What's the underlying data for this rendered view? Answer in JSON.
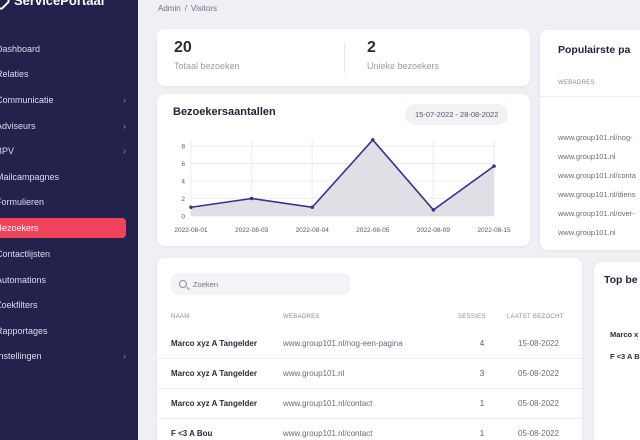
{
  "brand": {
    "name": "ServicePortaal"
  },
  "sidebar": {
    "items": [
      {
        "label": "Dashboard",
        "chevron": false
      },
      {
        "label": "Relaties",
        "chevron": false
      },
      {
        "label": "Communicatie",
        "chevron": true
      },
      {
        "label": "Adviseurs",
        "chevron": true
      },
      {
        "label": "BPV",
        "chevron": true
      },
      {
        "label": "Mailcampagnes",
        "chevron": false
      },
      {
        "label": "Formulieren",
        "chevron": false
      },
      {
        "label": "Bezoekers",
        "chevron": false,
        "active": true
      },
      {
        "label": "Contactlijsten",
        "chevron": false
      },
      {
        "label": "Automations",
        "chevron": false
      },
      {
        "label": "Zoekfilters",
        "chevron": false
      },
      {
        "label": "Rapportages",
        "chevron": false
      },
      {
        "label": "Instellingen",
        "chevron": true
      }
    ],
    "chevron_glyph": "›"
  },
  "breadcrumb": {
    "root": "Admin",
    "separator": "/",
    "current": "Visitors"
  },
  "stats": {
    "total": {
      "value": "20",
      "label": "Totaal bezoeken"
    },
    "unique": {
      "value": "2",
      "label": "Unieke bezoekers"
    }
  },
  "chart": {
    "title": "Bezoekersaantallen",
    "date_range": "15-07-2022 - 28-08-2022"
  },
  "chart_data": {
    "type": "area",
    "title": "Bezoekersaantallen",
    "categories": [
      "2022-08-01",
      "2022-08-03",
      "2022-08-04",
      "2022-08-05",
      "2022-08-09",
      "2022-08-15"
    ],
    "values": [
      1,
      2,
      1,
      8.7,
      0.7,
      5.7
    ],
    "ylim": [
      0,
      8
    ],
    "yticks": [
      0,
      2,
      4,
      6,
      8
    ],
    "grid": true,
    "colors": {
      "line": "#3b2f8f",
      "fill": "#dcdce2"
    }
  },
  "popular": {
    "title": "Populairste pa",
    "column": "WEBADRES",
    "rows": [
      "www.group101.nl/nog-",
      "www.group101.nl",
      "www.group101.nl/conta",
      "www.group101.nl/diens",
      "www.group101.nl/over-",
      "www.group101.nl"
    ]
  },
  "visitors": {
    "search_placeholder": "Zoeken",
    "columns": {
      "name": "NAAM",
      "url": "WEBADRES",
      "sessions": "SESSIES",
      "last": "LAATST BEZOCHT"
    },
    "rows": [
      {
        "name": "Marco xyz A Tangelder",
        "url": "www.group101.nl/nog-een-pagina",
        "sessions": "4",
        "last": "15-08-2022"
      },
      {
        "name": "Marco xyz A Tangelder",
        "url": "www.group101.nl",
        "sessions": "3",
        "last": "05-08-2022"
      },
      {
        "name": "Marco xyz A Tangelder",
        "url": "www.group101.nl/contact",
        "sessions": "1",
        "last": "05-08-2022"
      },
      {
        "name": "F <3 A Bou",
        "url": "www.group101.nl/contact",
        "sessions": "1",
        "last": "05-08-2022"
      }
    ]
  },
  "top": {
    "title": "Top be",
    "rows": [
      "Marco x",
      "F <3 A B"
    ]
  },
  "colors": {
    "sidebar_bg": "#25214d",
    "accent": "#f0435b",
    "page_bg": "#eef0f4"
  }
}
